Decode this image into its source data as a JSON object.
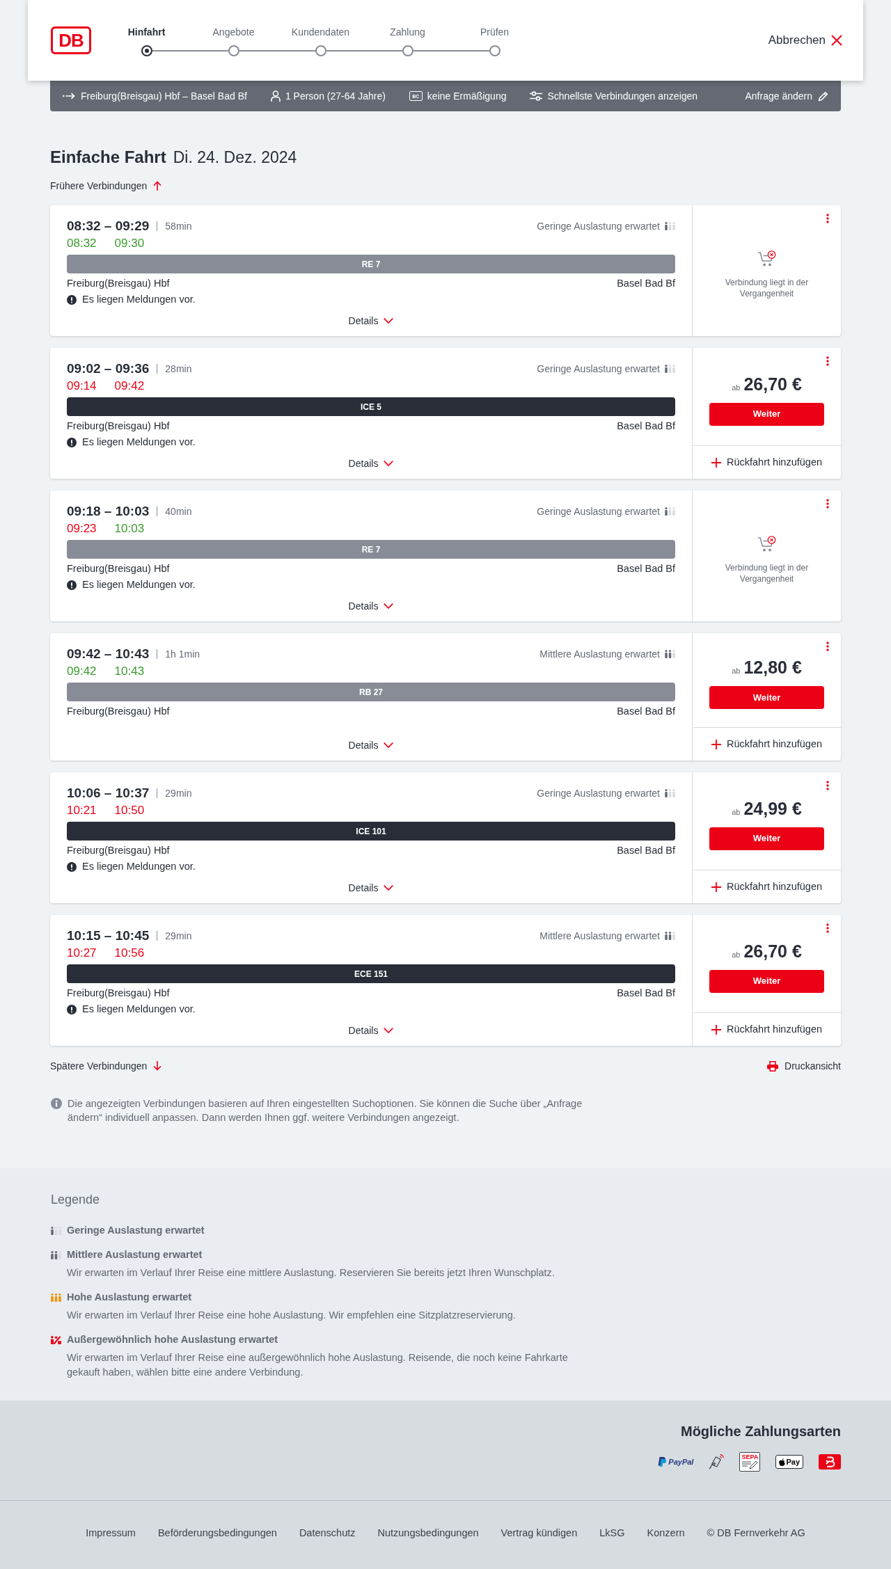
{
  "header": {
    "logo": "DB",
    "steps": [
      {
        "label": "Hinfahrt",
        "selected": true
      },
      {
        "label": "Angebote",
        "selected": false
      },
      {
        "label": "Kundendaten",
        "selected": false
      },
      {
        "label": "Zahlung",
        "selected": false
      },
      {
        "label": "Prüfen",
        "selected": false
      }
    ],
    "cancel": "Abbrechen"
  },
  "request_bar": {
    "route": "Freiburg(Breisgau) Hbf – Basel Bad Bf",
    "travellers": "1 Person (27-64 Jahre)",
    "discount_badge": "BC",
    "discount": "keine Ermäßigung",
    "option": "Schnellste Verbindungen anzeigen",
    "edit": "Anfrage ändern"
  },
  "title": {
    "trip_type": "Einfache Fahrt",
    "date": "Di. 24. Dez. 2024"
  },
  "earlier_link": "Frühere Verbindungen",
  "connections": [
    {
      "times": "08:32 – 09:29",
      "duration": "58min",
      "occupancy": {
        "label": "Geringe Auslastung erwartet",
        "kind": "low"
      },
      "realtime": [
        {
          "time": "08:32",
          "delayed": false
        },
        {
          "time": "09:30",
          "delayed": false
        }
      ],
      "train": {
        "label": "RE 7",
        "kind": "regional"
      },
      "from": "Freiburg(Breisgau) Hbf",
      "to": "Basel Bad Bf",
      "message": "Es liegen Meldungen vor.",
      "details": "Details",
      "booking": {
        "kind": "past",
        "text": "Verbindung liegt in der Vergangenheit"
      }
    },
    {
      "times": "09:02 – 09:36",
      "duration": "28min",
      "occupancy": {
        "label": "Geringe Auslastung erwartet",
        "kind": "low"
      },
      "realtime": [
        {
          "time": "09:14",
          "delayed": true
        },
        {
          "time": "09:42",
          "delayed": true
        }
      ],
      "train": {
        "label": "ICE 5",
        "kind": "long_distance"
      },
      "from": "Freiburg(Breisgau) Hbf",
      "to": "Basel Bad Bf",
      "message": "Es liegen Meldungen vor.",
      "details": "Details",
      "booking": {
        "kind": "offer",
        "prefix": "ab",
        "price": "26,70 €",
        "button": "Weiter",
        "return_trip": "Rückfahrt hinzufügen"
      }
    },
    {
      "times": "09:18 – 10:03",
      "duration": "40min",
      "occupancy": {
        "label": "Geringe Auslastung erwartet",
        "kind": "low"
      },
      "realtime": [
        {
          "time": "09:23",
          "delayed": true
        },
        {
          "time": "10:03",
          "delayed": false
        }
      ],
      "train": {
        "label": "RE 7",
        "kind": "regional"
      },
      "from": "Freiburg(Breisgau) Hbf",
      "to": "Basel Bad Bf",
      "message": "Es liegen Meldungen vor.",
      "details": "Details",
      "booking": {
        "kind": "past",
        "text": "Verbindung liegt in der Vergangenheit"
      }
    },
    {
      "times": "09:42 – 10:43",
      "duration": "1h 1min",
      "occupancy": {
        "label": "Mittlere Auslastung erwartet",
        "kind": "medium"
      },
      "realtime": [
        {
          "time": "09:42",
          "delayed": false
        },
        {
          "time": "10:43",
          "delayed": false
        }
      ],
      "train": {
        "label": "RB 27",
        "kind": "regional"
      },
      "from": "Freiburg(Breisgau) Hbf",
      "to": "Basel Bad Bf",
      "details": "Details",
      "booking": {
        "kind": "offer",
        "prefix": "ab",
        "price": "12,80 €",
        "button": "Weiter",
        "return_trip": "Rückfahrt hinzufügen"
      }
    },
    {
      "times": "10:06 – 10:37",
      "duration": "29min",
      "occupancy": {
        "label": "Geringe Auslastung erwartet",
        "kind": "low"
      },
      "realtime": [
        {
          "time": "10:21",
          "delayed": true
        },
        {
          "time": "10:50",
          "delayed": true
        }
      ],
      "train": {
        "label": "ICE 101",
        "kind": "long_distance"
      },
      "from": "Freiburg(Breisgau) Hbf",
      "to": "Basel Bad Bf",
      "message": "Es liegen Meldungen vor.",
      "details": "Details",
      "booking": {
        "kind": "offer",
        "prefix": "ab",
        "price": "24,99 €",
        "button": "Weiter",
        "return_trip": "Rückfahrt hinzufügen"
      }
    },
    {
      "times": "10:15 – 10:45",
      "duration": "29min",
      "occupancy": {
        "label": "Mittlere Auslastung erwartet",
        "kind": "medium"
      },
      "realtime": [
        {
          "time": "10:27",
          "delayed": true
        },
        {
          "time": "10:56",
          "delayed": true
        }
      ],
      "train": {
        "label": "ECE 151",
        "kind": "long_distance"
      },
      "from": "Freiburg(Breisgau) Hbf",
      "to": "Basel Bad Bf",
      "message": "Es liegen Meldungen vor.",
      "details": "Details",
      "booking": {
        "kind": "offer",
        "prefix": "ab",
        "price": "26,70 €",
        "button": "Weiter",
        "return_trip": "Rückfahrt hinzufügen"
      }
    }
  ],
  "later_link": "Spätere Verbindungen",
  "print_link": "Druckansicht",
  "info_text": "Die angezeigten Verbindungen basieren auf Ihren eingestellten Suchoptionen. Sie können die Suche über „Anfrage ändern“ individuell anpassen. Dann werden Ihnen ggf. weitere Verbindungen angezeigt.",
  "legend": {
    "title": "Legende",
    "items": [
      {
        "kind": "low",
        "title": "Geringe Auslastung erwartet"
      },
      {
        "kind": "medium",
        "title": "Mittlere Auslastung erwartet",
        "description": "Wir erwarten im Verlauf Ihrer Reise eine mittlere Auslastung. Reservieren Sie bereits jetzt Ihren Wunschplatz."
      },
      {
        "kind": "high",
        "title": "Hohe Auslastung erwartet",
        "description": "Wir erwarten im Verlauf Ihrer Reise eine hohe Auslastung. Wir empfehlen eine Sitzplatzreservierung."
      },
      {
        "kind": "very_high",
        "title": "Außergewöhnlich hohe Auslastung erwartet",
        "description": "Wir erwarten im Verlauf Ihrer Reise eine außergewöhnlich hohe Auslastung. Reisende, die noch keine Fahrkarte gekauft haben, wählen bitte eine andere Verbindung."
      }
    ]
  },
  "footer": {
    "payment_title": "Mögliche Zahlungsarten",
    "payment_methods": [
      {
        "kind": "paypal",
        "label": "PayPal"
      },
      {
        "kind": "contactless"
      },
      {
        "kind": "sepa",
        "label": "SEPA"
      },
      {
        "kind": "apple_pay",
        "label": "Pay"
      },
      {
        "kind": "voucher"
      }
    ],
    "links": [
      "Impressum",
      "Beförderungsbedingungen",
      "Datenschutz",
      "Nutzungsbedingungen",
      "Vertrag kündigen",
      "LkSG",
      "Konzern",
      "© DB Fernverkehr AG"
    ]
  }
}
